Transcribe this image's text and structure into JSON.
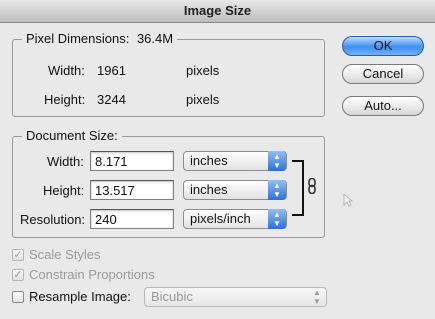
{
  "window": {
    "title": "Image Size"
  },
  "pixel_dimensions": {
    "label": "Pixel Dimensions:",
    "size": "36.4M",
    "width_label": "Width:",
    "width_value": "1961",
    "width_unit": "pixels",
    "height_label": "Height:",
    "height_value": "3244",
    "height_unit": "pixels"
  },
  "document_size": {
    "label": "Document Size:",
    "width_label": "Width:",
    "width_value": "8.171",
    "width_unit": "inches",
    "height_label": "Height:",
    "height_value": "13.517",
    "height_unit": "inches",
    "resolution_label": "Resolution:",
    "resolution_value": "240",
    "resolution_unit": "pixels/inch"
  },
  "buttons": {
    "ok": "OK",
    "cancel": "Cancel",
    "auto": "Auto..."
  },
  "options": {
    "scale_styles": {
      "label": "Scale Styles",
      "checked": true,
      "enabled": false
    },
    "constrain_proportions": {
      "label": "Constrain Proportions",
      "checked": true,
      "enabled": false
    },
    "resample_image": {
      "label": "Resample Image:",
      "checked": false,
      "enabled": true
    },
    "resample_method": "Bicubic"
  },
  "icons": {
    "link": "chain-link-icon",
    "checkmark": "✓",
    "select_arrows": "▲▼"
  },
  "colors": {
    "default_button": "#3d8ef5",
    "dialog_bg": "#e9e9e9"
  }
}
